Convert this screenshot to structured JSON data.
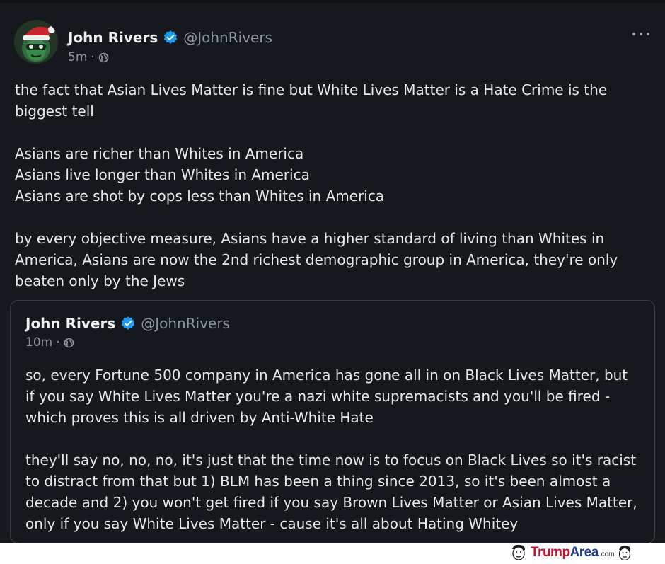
{
  "post": {
    "author": {
      "display_name": "John Rivers",
      "handle": "@JohnRivers",
      "verified_icon": "verified-badge-icon",
      "avatar_icon": "santa-hat-avatar-icon"
    },
    "meta": {
      "time": "5m",
      "separator": "·",
      "visibility_icon": "globe-icon"
    },
    "more_icon": "more-horizontal-icon",
    "paragraphs": [
      "the fact that Asian Lives Matter is fine but White Lives Matter is a Hate Crime is the biggest tell",
      "Asians are richer than Whites in America",
      "Asians live longer than Whites in America",
      "Asians are shot by cops less than Whites in America",
      "by every objective measure, Asians have a higher standard of living than Whites in America, Asians are now the 2nd richest demographic group in America, they're only beaten only by the Jews"
    ]
  },
  "quote": {
    "author": {
      "display_name": "John Rivers",
      "handle": "@JohnRivers"
    },
    "meta": {
      "time": "10m",
      "separator": "·"
    },
    "paragraphs": [
      "so, every Fortune 500 company in America has gone all in on Black Lives Matter, but if you say White Lives Matter you're a nazi white supremacists and you'll be fired - which proves this is all driven by Anti-White Hate",
      "they'll say no, no, no, it's just that the time now is to focus on Black Lives so it's racist to distract from that but 1) BLM has been a thing since 2013, so it's been almost a decade and 2) you won't get fired if you say Brown Lives Matter or Asian Lives Matter, only if you say White Lives Matter - cause it's all about Hating Whitey"
    ]
  },
  "watermark": {
    "trump": "Trump",
    "area": "Area",
    "com": ".com"
  },
  "colors": {
    "background": "#15181c",
    "text": "#e6e8ea",
    "secondary_text": "#8b96a0",
    "verified": "#1d9bf0",
    "quote_border": "#3a3f45"
  }
}
